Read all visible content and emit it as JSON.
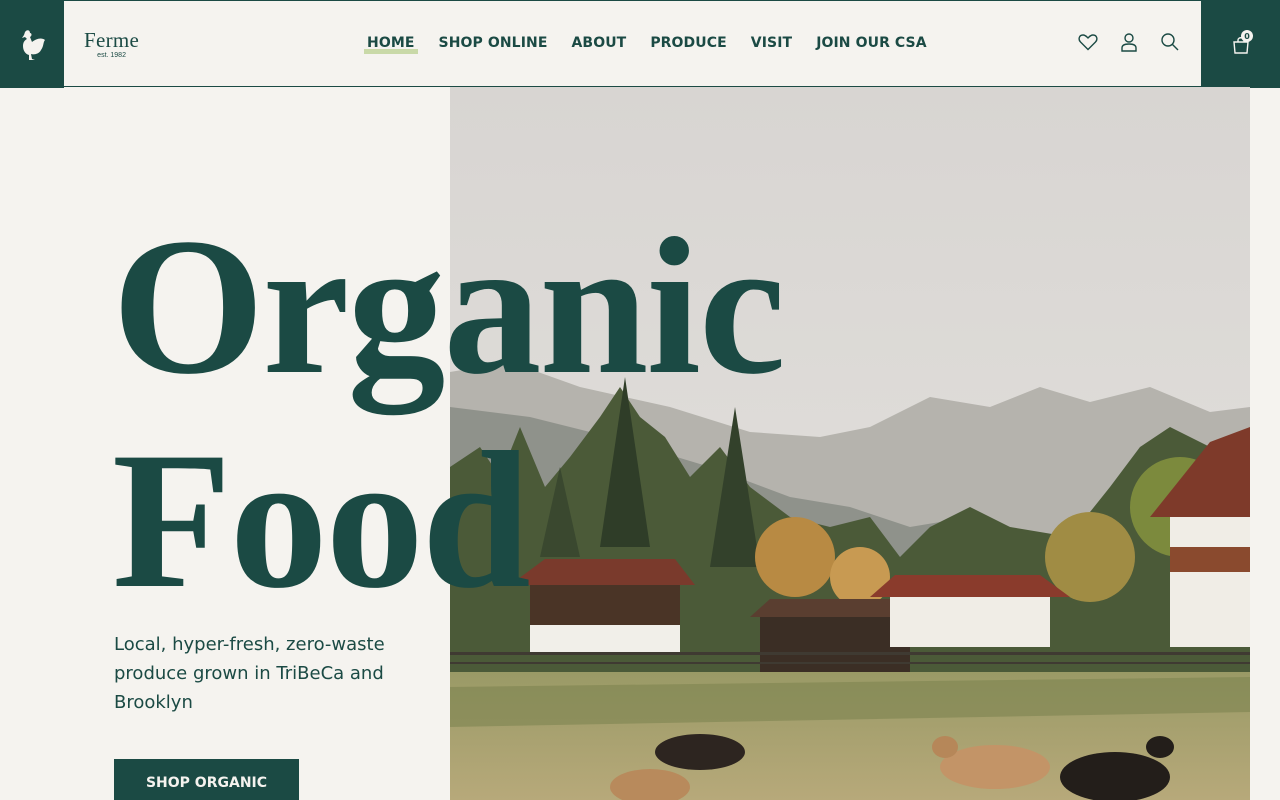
{
  "brand": {
    "name": "Ferme",
    "established": "est. 1982"
  },
  "nav": {
    "items": [
      {
        "label": "HOME",
        "active": true
      },
      {
        "label": "SHOP ONLINE"
      },
      {
        "label": "ABOUT"
      },
      {
        "label": "PRODUCE"
      },
      {
        "label": "VISIT"
      },
      {
        "label": "JOIN OUR CSA"
      }
    ]
  },
  "header_icons": [
    "heart-icon",
    "user-icon",
    "search-icon"
  ],
  "cart": {
    "count": "0"
  },
  "hero": {
    "headline_line1": "Organic",
    "headline_line2": "Food",
    "tagline": "Local, hyper-fresh, zero-waste produce grown in TriBeCa and Brooklyn",
    "cta_label": "SHOP ORGANIC"
  },
  "colors": {
    "primary": "#1b4a44",
    "background": "#f5f3ef",
    "nav_highlight": "#c9d9a8"
  }
}
